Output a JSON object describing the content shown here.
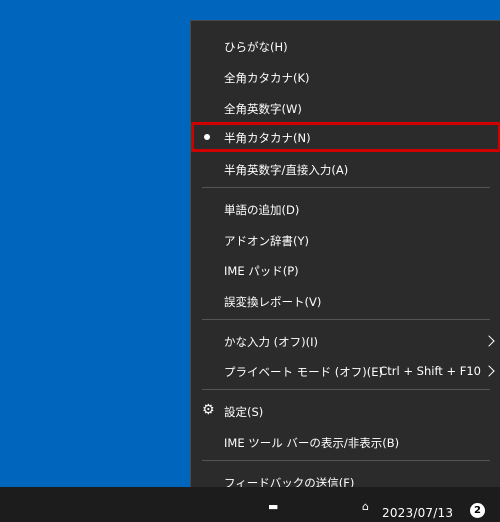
{
  "menu": {
    "items": [
      {
        "label": "ひらがな(H)",
        "checked": false
      },
      {
        "label": "全角カタカナ(K)",
        "checked": false
      },
      {
        "label": "全角英数字(W)",
        "checked": false
      },
      {
        "label": "半角カタカナ(N)",
        "checked": true
      },
      {
        "label": "半角英数字/直接入力(A)",
        "checked": false
      },
      {
        "label": "単語の追加(D)"
      },
      {
        "label": "アドオン辞書(Y)"
      },
      {
        "label": "IME パッド(P)"
      },
      {
        "label": "誤変換レポート(V)"
      },
      {
        "label": "かな入力 (オフ)(I)",
        "has_submenu": true
      },
      {
        "label": "プライベート モード (オフ)(E)",
        "shortcut": "Ctrl + Shift + F10",
        "has_submenu": true
      },
      {
        "label": "設定(S)",
        "icon": "gear-icon"
      },
      {
        "label": "IME ツール バーの表示/非表示(B)"
      },
      {
        "label": "フィードバックの送信(F)"
      }
    ]
  },
  "taskbar": {
    "date": "2023/07/13",
    "notification_count": "2"
  },
  "colors": {
    "desktop": "#0065bd",
    "menu_bg": "#2b2b2b",
    "highlight_border": "#d10000"
  }
}
